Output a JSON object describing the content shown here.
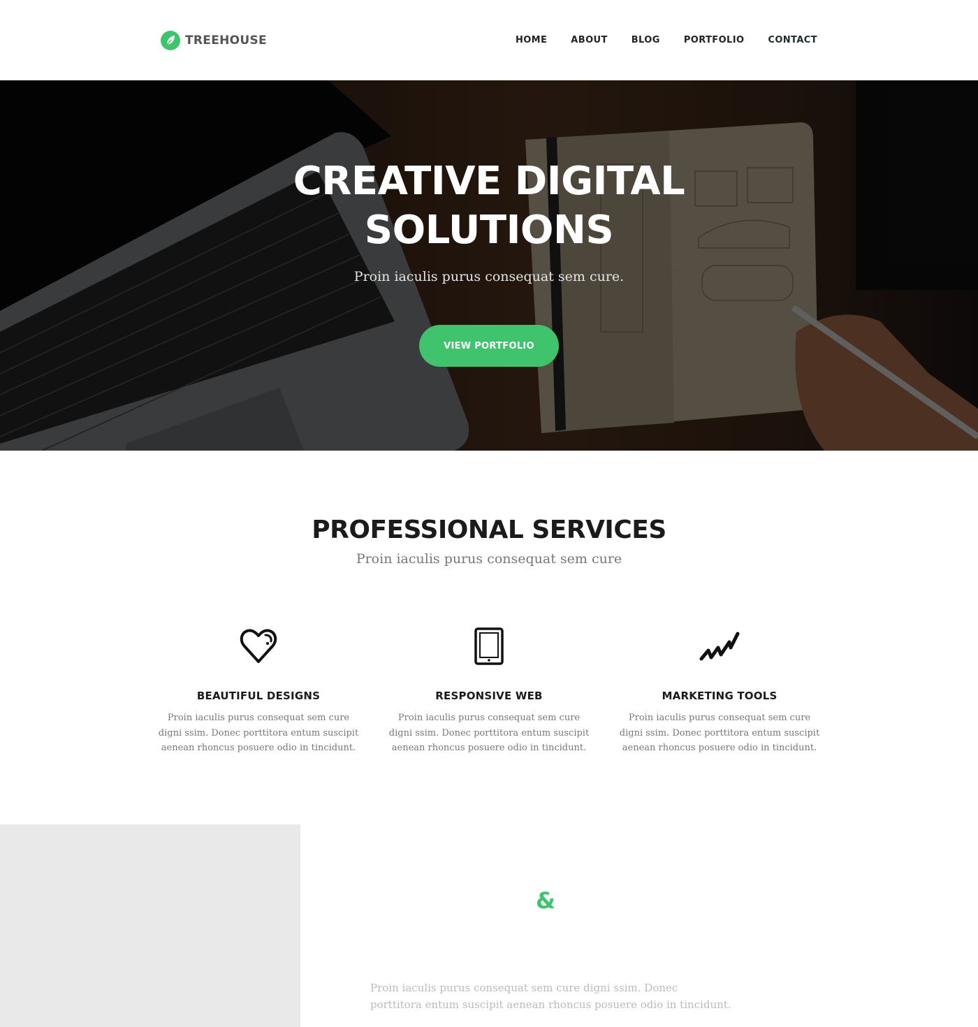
{
  "brand": {
    "name": "TREEHOUSE",
    "color": "#3fc36d",
    "icon": "leaf-icon"
  },
  "nav": {
    "items": [
      {
        "label": "HOME"
      },
      {
        "label": "ABOUT"
      },
      {
        "label": "BLOG"
      },
      {
        "label": "PORTFOLIO"
      },
      {
        "label": "CONTACT"
      }
    ]
  },
  "hero": {
    "title_line1": "CREATIVE DIGITAL",
    "title_line2": "SOLUTIONS",
    "subtitle": "Proin iaculis purus consequat sem cure.",
    "button_label": "VIEW PORTFOLIO"
  },
  "services": {
    "title": "PROFESSIONAL SERVICES",
    "subtitle": "Proin iaculis purus consequat sem cure",
    "items": [
      {
        "icon": "heart-icon",
        "name": "BEAUTIFUL DESIGNS",
        "desc": "Proin iaculis purus consequat sem cure digni ssim. Donec porttitora entum suscipit aenean rhoncus posuere odio in tincidunt."
      },
      {
        "icon": "tablet-icon",
        "name": "RESPONSIVE WEB",
        "desc": "Proin iaculis purus consequat sem cure digni ssim. Donec porttitora entum suscipit aenean rhoncus posuere odio in tincidunt."
      },
      {
        "icon": "trend-icon",
        "name": "MARKETING TOOLS",
        "desc": "Proin iaculis purus consequat sem cure digni ssim. Donec porttitora entum suscipit aenean rhoncus posuere odio in tincidunt."
      }
    ]
  },
  "about": {
    "symbol": "&",
    "text_line1": "Proin iaculis purus consequat sem cure  digni ssim. Donec",
    "text_line2": "porttitora entum suscipit  aenean rhoncus posuere odio in tincidunt."
  }
}
